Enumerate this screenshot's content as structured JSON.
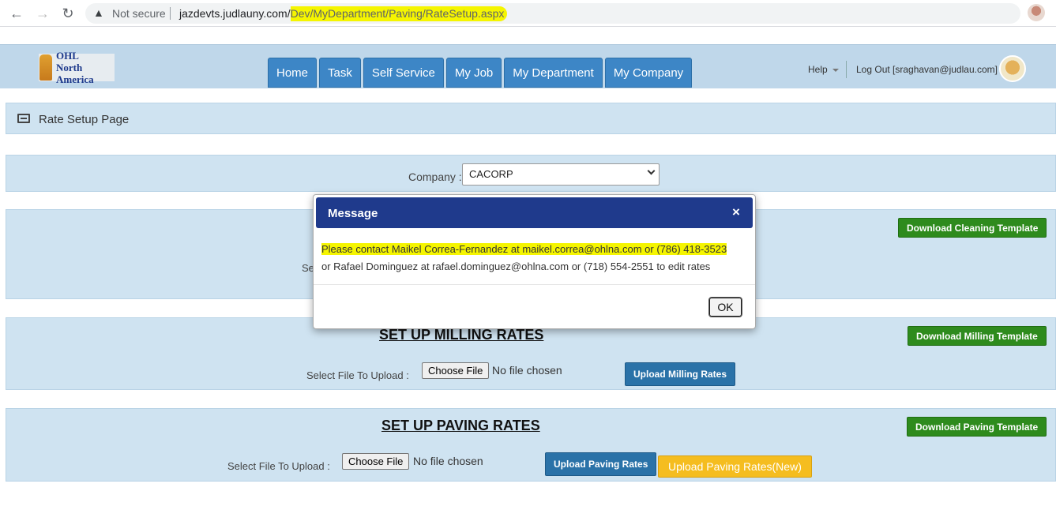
{
  "browser": {
    "back_icon": "arrow-left-icon",
    "forward_icon": "arrow-right-icon",
    "reload_icon": "reload-icon",
    "security_label": "Not secure",
    "url_host": "jazdevts.judlauny.com/",
    "url_path": "Dev/MyDepartment/Paving/RateSetup.aspx",
    "highlight_color": "#f5f500"
  },
  "header": {
    "logo_text_line1": "OHL",
    "logo_text_line2": "North America",
    "menu": [
      "Home",
      "Task",
      "Self Service",
      "My Job",
      "My Department",
      "My Company"
    ],
    "help_label": "Help",
    "logout_label": "Log Out [sraghavan@judlau.com]",
    "accent_color": "#3d86c6"
  },
  "page": {
    "title": "Rate Setup Page",
    "company_label": "Company :",
    "company_value": "CACORP"
  },
  "cleaning": {
    "download_label": "Download Cleaning Template",
    "partial_label": "Se"
  },
  "milling": {
    "title": "SET UP MILLING RATES",
    "file_label": "Select File To Upload :",
    "choose_label": "Choose File",
    "no_file": "No file chosen",
    "upload_label": "Upload Milling Rates",
    "download_label": "Download Milling Template"
  },
  "paving": {
    "title": "SET UP PAVING RATES",
    "file_label": "Select File To Upload :",
    "choose_label": "Choose File",
    "no_file": "No file chosen",
    "upload_label": "Upload Paving Rates",
    "upload_new_label": "Upload Paving Rates(New)",
    "download_label": "Download Paving Template"
  },
  "modal": {
    "title": "Message",
    "close_glyph": "×",
    "line1": "Please contact Maikel Correa-Fernandez at maikel.correa@ohlna.com or (786) 418-3523",
    "line2": "or Rafael Dominguez at rafael.dominguez@ohlna.com or (718) 554-2551 to edit rates",
    "ok_label": "OK",
    "header_color": "#1f3a8c"
  }
}
